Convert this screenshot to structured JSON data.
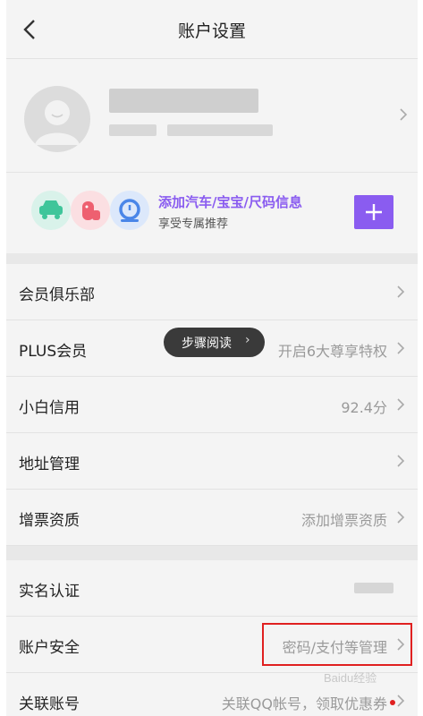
{
  "header": {
    "title": "账户设置",
    "back_icon": "chevron-left-icon"
  },
  "profile": {
    "avatar_icon": "default-avatar-icon",
    "chevron_icon": "chevron-right-icon"
  },
  "promo": {
    "title": "添加汽车/宝宝/尺码信息",
    "subtitle": "享受专属推荐",
    "icons": [
      "car-icon",
      "baby-icon",
      "measure-icon"
    ],
    "icon_colors": [
      "#3fc59a",
      "#ee6070",
      "#4a86e8"
    ],
    "add_icon": "plus-icon",
    "accent_color": "#8a5cf0"
  },
  "rows": [
    {
      "label": "会员俱乐部",
      "value": ""
    },
    {
      "label": "PLUS会员",
      "value": "开启6大尊享特权"
    },
    {
      "label": "小白信用",
      "value": "92.4分"
    },
    {
      "label": "地址管理",
      "value": ""
    },
    {
      "label": "增票资质",
      "value": "添加增票资质"
    },
    {
      "label": "实名认证",
      "value": ""
    },
    {
      "label": "账户安全",
      "value": "密码/支付等管理"
    },
    {
      "label": "关联账号",
      "value": "关联QQ帐号，领取优惠券"
    }
  ],
  "overlay": {
    "step_reading": "步骤阅读",
    "chevron": "›"
  },
  "watermark": "Baidu经验",
  "highlight_color": "#e02020"
}
